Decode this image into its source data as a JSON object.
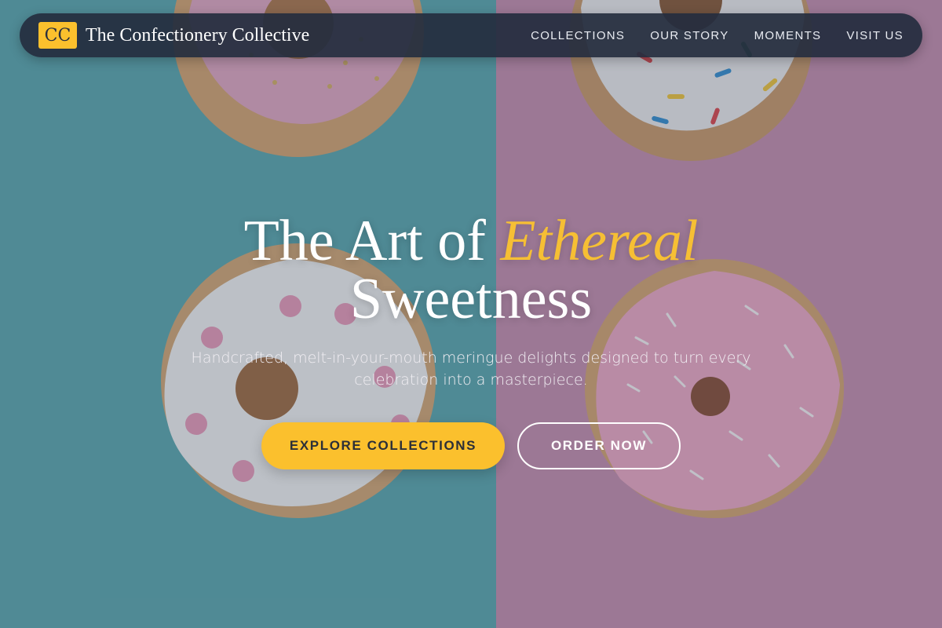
{
  "navbar": {
    "logo_initials": "CC",
    "brand_name": "The Confectionery Collective",
    "links": [
      "COLLECTIONS",
      "OUR STORY",
      "MOMENTS",
      "VISIT US"
    ]
  },
  "hero": {
    "title_part1": "The Art of ",
    "title_highlight": "Ethereal",
    "title_part2": "Sweetness",
    "subtitle": "Handcrafted, melt-in-your-mouth meringue delights designed to turn every celebration into a masterpiece.",
    "primary_button": "EXPLORE COLLECTIONS",
    "secondary_button": "ORDER NOW"
  },
  "colors": {
    "accent": "#fbc02d",
    "navbar_bg": "#242c3e",
    "background_left": "#5fa8b0",
    "background_right": "#c98fb0"
  }
}
